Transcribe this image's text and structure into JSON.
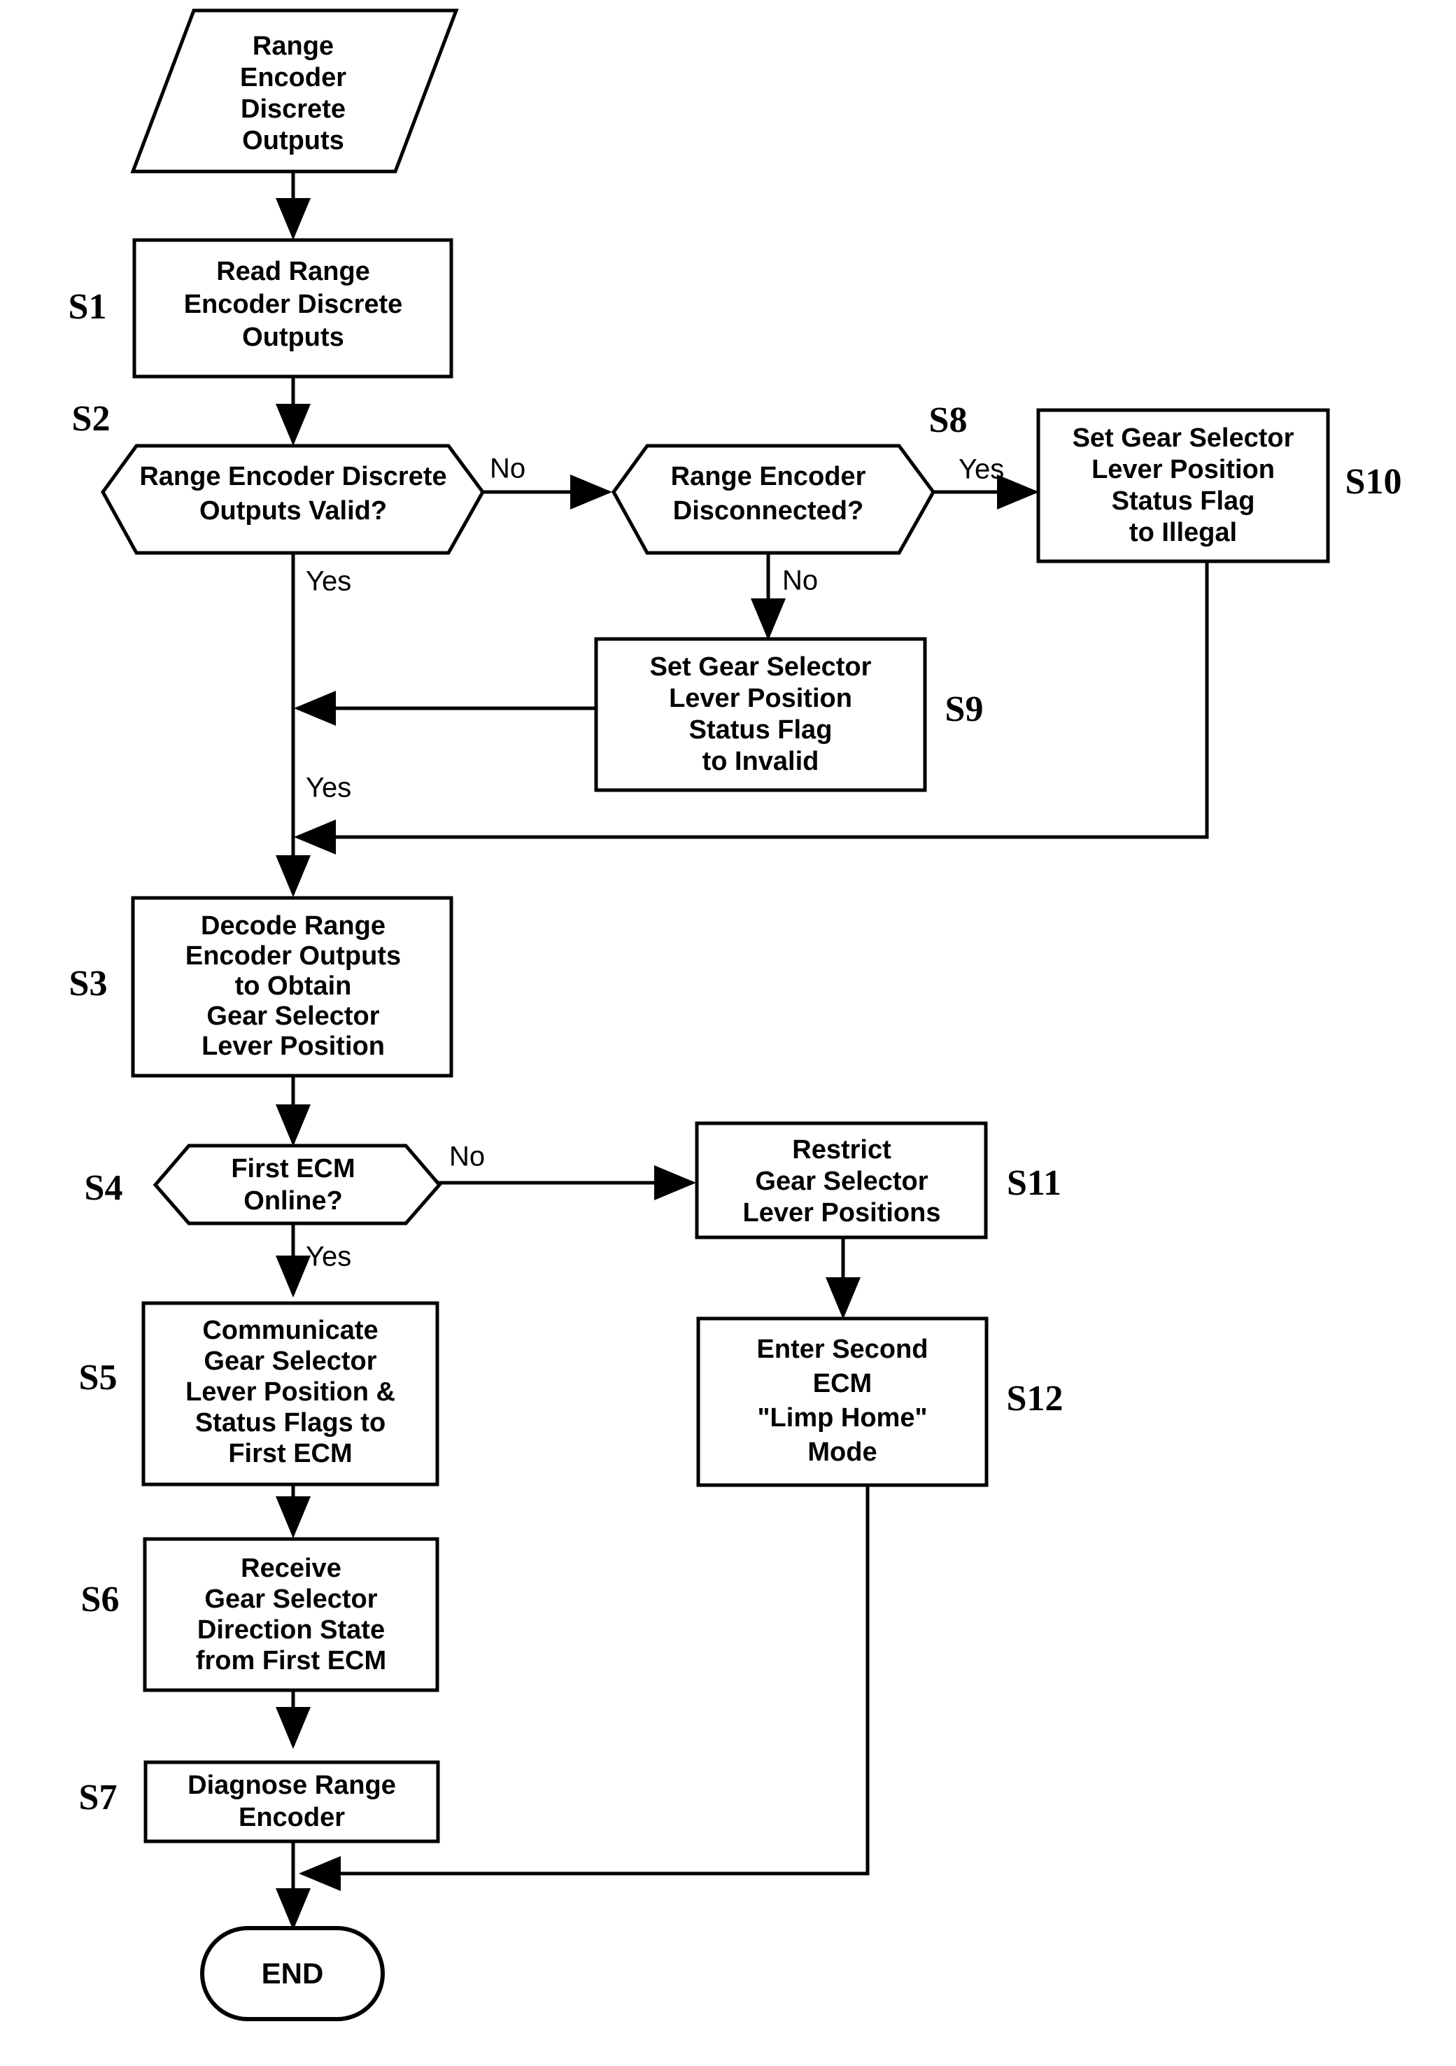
{
  "diagram": {
    "title": "Gear Selector Range Encoder Diagnostic Flowchart",
    "type": "flowchart",
    "nodes": [
      {
        "id": "input",
        "step": "",
        "shape": "parallelogram",
        "lines": [
          "Range",
          "Encoder",
          "Discrete",
          "Outputs"
        ]
      },
      {
        "id": "S1",
        "step": "S1",
        "shape": "process",
        "lines": [
          "Read Range",
          "Encoder Discrete",
          "Outputs"
        ]
      },
      {
        "id": "S2",
        "step": "S2",
        "shape": "decision",
        "lines": [
          "Range Encoder Discrete",
          "Outputs Valid?"
        ]
      },
      {
        "id": "S8",
        "step": "S8",
        "shape": "decision",
        "lines": [
          "Range Encoder",
          "Disconnected?"
        ]
      },
      {
        "id": "S10",
        "step": "S10",
        "shape": "process",
        "lines": [
          "Set Gear Selector",
          "Lever Position",
          "Status Flag",
          "to Illegal"
        ]
      },
      {
        "id": "S9",
        "step": "S9",
        "shape": "process",
        "lines": [
          "Set Gear Selector",
          "Lever Position",
          "Status Flag",
          "to Invalid"
        ]
      },
      {
        "id": "S3",
        "step": "S3",
        "shape": "process",
        "lines": [
          "Decode Range",
          "Encoder Outputs",
          "to Obtain",
          "Gear Selector",
          "Lever Position"
        ]
      },
      {
        "id": "S4",
        "step": "S4",
        "shape": "decision",
        "lines": [
          "First ECM",
          "Online?"
        ]
      },
      {
        "id": "S11",
        "step": "S11",
        "shape": "process",
        "lines": [
          "Restrict",
          "Gear Selector",
          "Lever Positions"
        ]
      },
      {
        "id": "S5",
        "step": "S5",
        "shape": "process",
        "lines": [
          "Communicate",
          "Gear Selector",
          "Lever Position &",
          "Status Flags to",
          "First ECM"
        ]
      },
      {
        "id": "S12",
        "step": "S12",
        "shape": "process",
        "lines": [
          "Enter Second",
          "ECM",
          "\"Limp Home\"",
          "Mode"
        ]
      },
      {
        "id": "S6",
        "step": "S6",
        "shape": "process",
        "lines": [
          "Receive",
          "Gear Selector",
          "Direction State",
          "from First ECM"
        ]
      },
      {
        "id": "S7",
        "step": "S7",
        "shape": "process",
        "lines": [
          "Diagnose Range",
          "Encoder"
        ]
      },
      {
        "id": "END",
        "step": "",
        "shape": "terminator",
        "lines": [
          "END"
        ]
      }
    ],
    "edge_labels": {
      "s2_no": "No",
      "s2_yes": "Yes",
      "s8_yes": "Yes",
      "s8_no": "No",
      "merge_yes": "Yes",
      "s4_no": "No",
      "s4_yes": "Yes"
    },
    "colors": {
      "line": "#000000",
      "fill": "#ffffff",
      "text": "#000000"
    }
  }
}
